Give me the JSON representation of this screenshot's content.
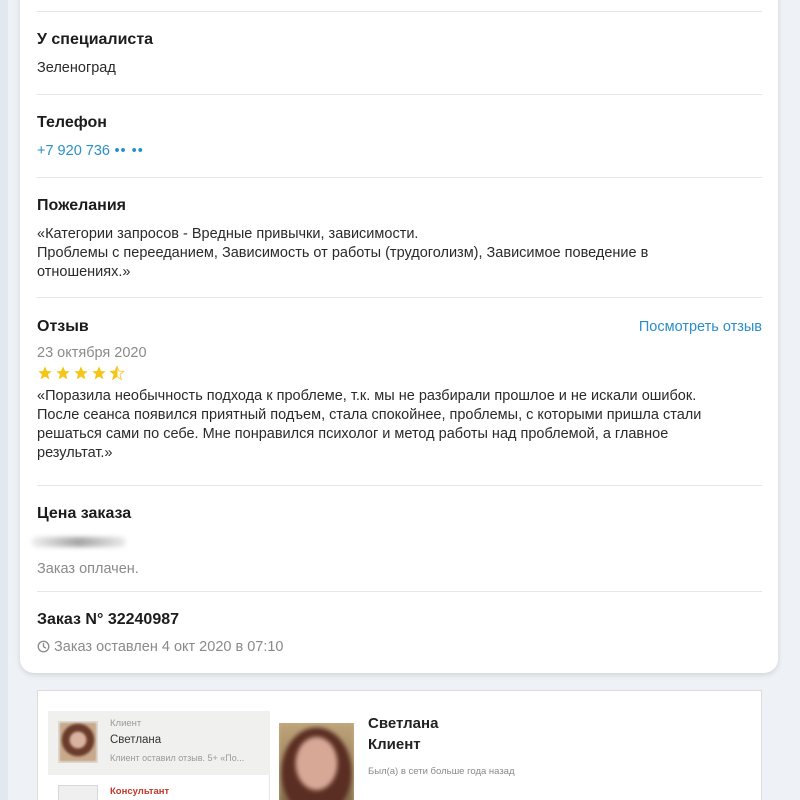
{
  "specialist": {
    "heading": "У специалиста",
    "value": "Зеленоград"
  },
  "phone": {
    "heading": "Телефон",
    "value": "+7 920 736",
    "masked": "•• ••"
  },
  "wishes": {
    "heading": "Пожелания",
    "line1": "«Категории запросов - Вредные привычки, зависимости.",
    "line2": "Проблемы с перееданием, Зависимость от работы (трудоголизм), Зависимое поведение в",
    "line3": "отношениях.»"
  },
  "review": {
    "heading": "Отзыв",
    "view_link": "Посмотреть отзыв",
    "date": "23 октября 2020",
    "rating": 4.5,
    "star_color": "#f5c518",
    "line1": "«Поразила необычность подхода к проблеме, т.к. мы не разбирали прошлое и не искали ошибок.",
    "line2": "После сеанса появился приятный подъем, стала спокойнее, проблемы, с которыми пришла стали",
    "line3": "решаться сами по себе. Мне понравился психолог и метод работы над проблемой, а главное",
    "line4": "результат.»"
  },
  "price": {
    "heading": "Цена заказа",
    "status": "Заказ оплачен."
  },
  "order": {
    "heading": "Заказ N° 32240987",
    "created": "Заказ оставлен 4 окт 2020 в 07:10",
    "icon": "clock-icon"
  },
  "chat": {
    "items": [
      {
        "role": "Клиент",
        "name": "Светлана",
        "preview": "Клиент оставил отзыв. 5+ «По..."
      },
      {
        "role": "Консультант"
      }
    ],
    "profile": {
      "name": "Светлана",
      "role": "Клиент",
      "status": "Был(а) в сети больше года назад"
    }
  },
  "colors": {
    "link": "#2a8fc9",
    "consultant_red": "#c0392b"
  }
}
